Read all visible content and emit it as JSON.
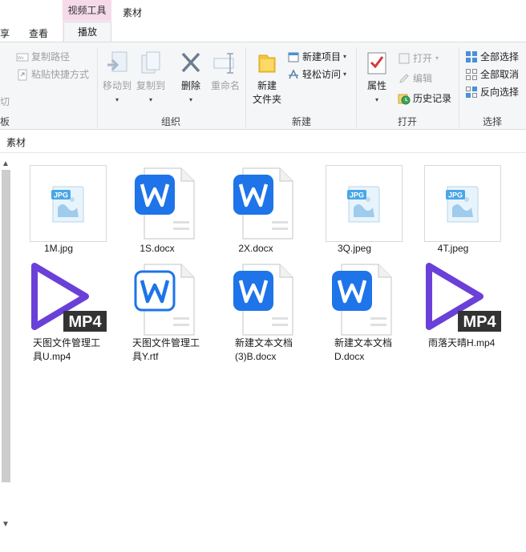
{
  "tabs": {
    "share": "享",
    "view": "查看",
    "context_group": "视频工具",
    "context_tab": "播放",
    "folder_title": "素材"
  },
  "ribbon": {
    "clipboard": {
      "copy_path": "复制路径",
      "paste_shortcut": "粘贴快捷方式",
      "cut": "切",
      "label": "板"
    },
    "organize": {
      "move_to": "移动到",
      "copy_to": "复制到",
      "delete": "删除",
      "rename": "重命名",
      "label": "组织"
    },
    "new": {
      "new_folder_line1": "新建",
      "new_folder_line2": "文件夹",
      "new_item": "新建项目",
      "easy_access": "轻松访问",
      "label": "新建"
    },
    "open": {
      "properties": "属性",
      "open": "打开",
      "edit": "编辑",
      "history": "历史记录",
      "label": "打开"
    },
    "select": {
      "select_all": "全部选择",
      "select_none": "全部取消",
      "invert": "反向选择",
      "label": "选择"
    }
  },
  "address": {
    "path": "素材"
  },
  "files": [
    {
      "line1": "1M.jpg",
      "line2": "",
      "type": "jpg"
    },
    {
      "line1": "1S.docx",
      "line2": "",
      "type": "docx"
    },
    {
      "line1": "2X.docx",
      "line2": "",
      "type": "docx"
    },
    {
      "line1": "3Q.jpeg",
      "line2": "",
      "type": "jpg"
    },
    {
      "line1": "4T.jpeg",
      "line2": "",
      "type": "jpg"
    },
    {
      "line1": "天图文件管理工",
      "line2": "具U.mp4",
      "type": "mp4"
    },
    {
      "line1": "天图文件管理工",
      "line2": "具Y.rtf",
      "type": "rtf"
    },
    {
      "line1": "新建文本文档",
      "line2": "(3)B.docx",
      "type": "docx"
    },
    {
      "line1": "新建文本文档",
      "line2": "D.docx",
      "type": "docx"
    },
    {
      "line1": "雨落天晴H.mp4",
      "line2": "",
      "type": "mp4"
    }
  ],
  "icons": {
    "jpg_badge": "JPG",
    "mp4_badge": "MP4",
    "word_letter": "W"
  },
  "colors": {
    "word_blue": "#1e74e8",
    "mp4_purple": "#6a40d8",
    "jpg_blue": "#4aa7e6",
    "context_pink": "#f5dbe9"
  }
}
